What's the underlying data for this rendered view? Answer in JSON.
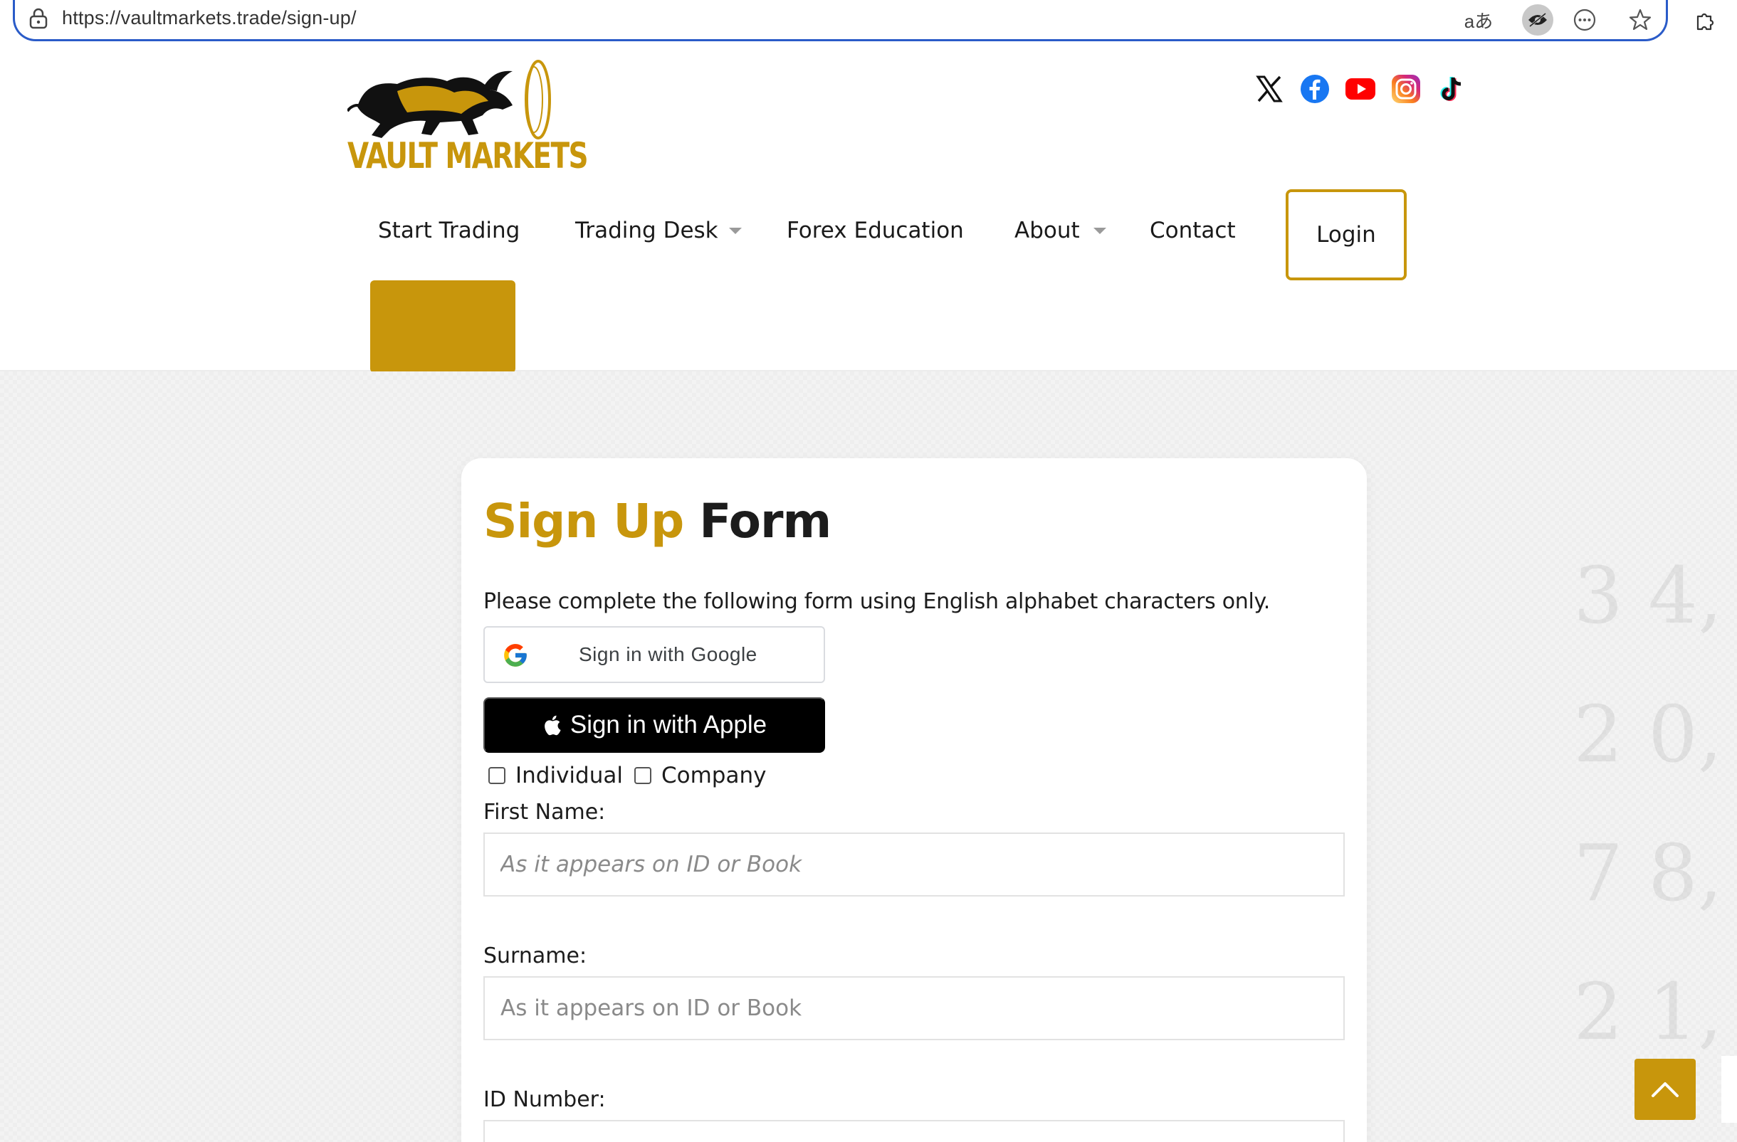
{
  "browser": {
    "url": "https://vaultmarkets.trade/sign-up/",
    "translate_glyph": "aあ"
  },
  "header": {
    "logo_text": "VAULT MARKETS",
    "social": [
      "x-icon",
      "facebook-icon",
      "youtube-icon",
      "instagram-icon",
      "tiktok-icon"
    ],
    "nav": {
      "start_trading": "Start Trading",
      "trading_desk": "Trading Desk",
      "forex_education": "Forex Education",
      "about": "About",
      "contact": "Contact",
      "login": "Login"
    }
  },
  "form": {
    "title_accent": "Sign Up",
    "title_rest": "Form",
    "instructions": "Please complete the following form using English alphabet characters only.",
    "google_label": "Sign in with Google",
    "apple_label": "Sign in with Apple",
    "type_options": [
      "Individual",
      "Company"
    ],
    "first_name_label": "First Name:",
    "first_name_placeholder": "As it appears on ID or Book",
    "surname_label": "Surname:",
    "surname_placeholder": "As it appears on ID or Book",
    "id_number_label": "ID Number:"
  },
  "colors": {
    "brand_gold": "#c8960c",
    "address_bar_border": "#2a5bc8",
    "apple_button": "#000000"
  }
}
